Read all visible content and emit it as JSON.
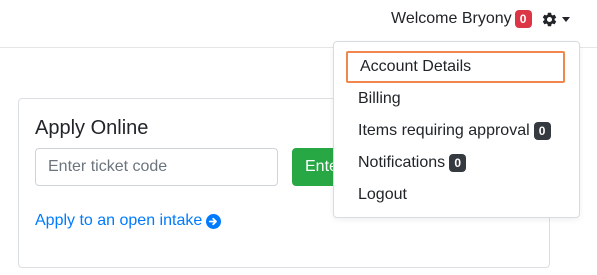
{
  "navbar": {
    "welcome_text": "Welcome Bryony",
    "welcome_badge": "0",
    "settings_icon": "gear-icon",
    "caret_icon": "caret-down-icon"
  },
  "card": {
    "title": "Apply Online",
    "ticket_input": {
      "placeholder": "Enter ticket code",
      "value": ""
    },
    "enter_button_label": "Ente",
    "intake_link_text": "Apply to an open intake",
    "intake_link_icon": "arrow-circle-right-icon"
  },
  "dropdown": {
    "items": [
      {
        "label": "Account Details",
        "highlighted": true
      },
      {
        "label": "Billing"
      },
      {
        "label": "Items requiring approval",
        "badge": "0"
      },
      {
        "label": "Notifications",
        "badge": "0"
      },
      {
        "label": "Logout"
      }
    ]
  },
  "colors": {
    "primary_link": "#007bff",
    "success_button": "#28a745",
    "danger_badge": "#dc3545",
    "dark_badge": "#343a40",
    "highlight_outline": "#f0884d"
  }
}
